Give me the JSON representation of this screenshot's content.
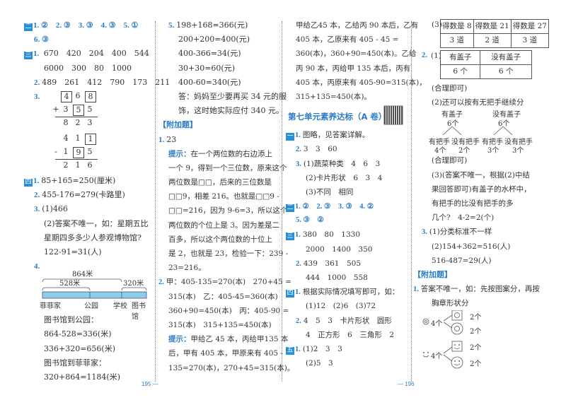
{
  "col1": {
    "s2": {
      "badge": "二",
      "items": "1. ②　2. ③　3. ③　4. ③　5. ①",
      "l2": "6. ③"
    },
    "s3": {
      "badge": "三",
      "q1a": "670　420　204　400　544",
      "q1b": "6000　300　80　1000",
      "q2": "489　261　412　790　173　211",
      "q3": "3.",
      "calcA": [
        [
          "4",
          "6",
          "8"
        ],
        [
          "+",
          "3",
          "5",
          "5"
        ],
        [
          "8",
          "2",
          "3"
        ]
      ],
      "calcB": [
        [
          "4",
          "1",
          "1"
        ],
        [
          "-",
          "1",
          "9",
          "5"
        ],
        [
          "2",
          "1",
          "6"
        ]
      ]
    },
    "s4": {
      "badge": "四",
      "q1": "85+165=250(厘米)",
      "q2": "455-176=279(卡路里)",
      "q3a": "(1)466",
      "q3b": "(2)答案不唯一，如：星期五比",
      "q3c": "星期四多多少人参观博物馆?",
      "q3d": "122-91=31(人)",
      "q4": "4.",
      "diagram": {
        "total": "864米",
        "part1": "528米",
        "part2": "320米",
        "places": [
          "菲菲家",
          "公园",
          "学校",
          "图书馆"
        ]
      },
      "l1": "图书馆到公园：",
      "l2": "864-528=336(米)",
      "l3": "336+320=656(米)",
      "l4": "图书馆到菲菲家：",
      "l5": "320+864=1184(米)"
    }
  },
  "col2": {
    "q5": [
      "198+168=366(元)",
      "200+200=400(元)",
      "400-366=34(元)",
      "30+30=60(元)",
      "400-60=340(元)",
      "答：妈妈至少要再买 34 元的服",
      "饰，这时她实际应付 340 元。"
    ],
    "extra": "【附加题】",
    "e1": "23",
    "hint": "提示：",
    "e1lines": [
      "在一个两位数的右边添上",
      "一个 9，得到一个三位数，原来这个",
      "两位数是□□，后来的三位数是",
      "□□9，相差 216。也就是□□9 -",
      "□□=216，因为 9-6=3，所以这个",
      "两位数的个位上是 3。因为差是二",
      "百多，所以这个两位数的十位上",
      "是 2，也就是 23，检验一下：239 -",
      "23=216。"
    ],
    "e2lines": [
      "甲：405-135=270(本)　270+45 =",
      "315(本)　乙：405-45=360(本)",
      "360+90=450(本)　丙：405-90 =",
      "315(本)　315+135=450(本)"
    ],
    "hint2": [
      "甲给乙 45 本，丙给甲135 本",
      "后，甲有 405 本，甲原来有 405 -",
      "135=270(本)，270+45=315(本)。"
    ]
  },
  "col3": {
    "top": [
      "甲给乙45 本，乙给丙 90 本后，乙有",
      "405 本，乙原来有 405 - 45 =",
      "360(本)，360+90=450(本)。乙给",
      "丙 90 本，丙给甲 135 本后，丙有",
      "405 本，丙原来有 405-90=315(本)，",
      "315+135=450(本)。"
    ],
    "title": "第七单元素养达标（A 卷）",
    "s1": {
      "badge": "一",
      "q1": "图略，见答案详解。",
      "q2": "3　3　60",
      "q3a": "(1)蔬菜种类　4　6　3",
      "q3b": "(2)卡片形状　6　3　4",
      "q3c": "(3)不同　相同"
    },
    "s2": {
      "badge": "二",
      "l1": "1. ②　2. ③　3. ③　4. ②",
      "l2": "5. ③　②"
    },
    "s3": {
      "badge": "三",
      "q1a": "380　80　1330",
      "q1b": "2000　1400　350",
      "q2a": "439　361　505",
      "q2b": "444　1000　558"
    },
    "s4": {
      "badge": "四",
      "q1": "根据实际情况填写即可，如：",
      "q1b": "(1)12　(2)6　(3)72",
      "q2a": "4　5　3　卡片形状　圆形",
      "q2b": "4　正方形　6　三角形　2"
    },
    "s5": {
      "badge": "五",
      "q1a": "(1)2　3　3",
      "q1b": "(2)5　3"
    }
  },
  "col4": {
    "t1label": "(3)",
    "t1": {
      "head": [
        "得数是 8",
        "得数是 21",
        "得数是 27"
      ],
      "row": [
        "3 道",
        "2 道",
        "3 道"
      ]
    },
    "t2label": "(1)",
    "t2": {
      "head": [
        "有盖子",
        "没有盖子"
      ],
      "row": [
        "6 个",
        "6 个"
      ]
    },
    "ok1": "(合理即可)",
    "q2": "(2)还可以按有无把手继续分",
    "tree": {
      "left": {
        "top": "有盖子",
        "count": "6个",
        "a": "有把手",
        "an": "4个",
        "b": "没有把手",
        "bn": "2个"
      },
      "right": {
        "top": "没有盖子",
        "count": "6个",
        "a": "有把手",
        "an": "3个",
        "b": "没有把手",
        "bn": "3个"
      }
    },
    "ok2": "(合理即可)",
    "q3lines": [
      "(3)(答案不唯一，根据(2)中结",
      "果回答即可)有盖子的水杯中，",
      "有把手的比没有把手的多",
      "几个?　4-2=2(个)"
    ],
    "s3a": "(1)分类标准不一样",
    "s3b": "(2)154+362=516(人)",
    "s3c": "516-487=29(人)",
    "extra": "【附加题】",
    "e1a": "答案不唯一，如：先按图案分，再按",
    "e1b": "胸章形状分",
    "flower": {
      "total": "4个",
      "a": "2个",
      "b": "2个"
    },
    "smile": {
      "total": "4个",
      "a": "2个",
      "b": "2个"
    }
  },
  "footer": {
    "left": "195 —",
    "right": "— 196"
  },
  "nums": {
    "n1": "1.",
    "n2": "2.",
    "n3": "3.",
    "n4": "4.",
    "n5": "5."
  }
}
